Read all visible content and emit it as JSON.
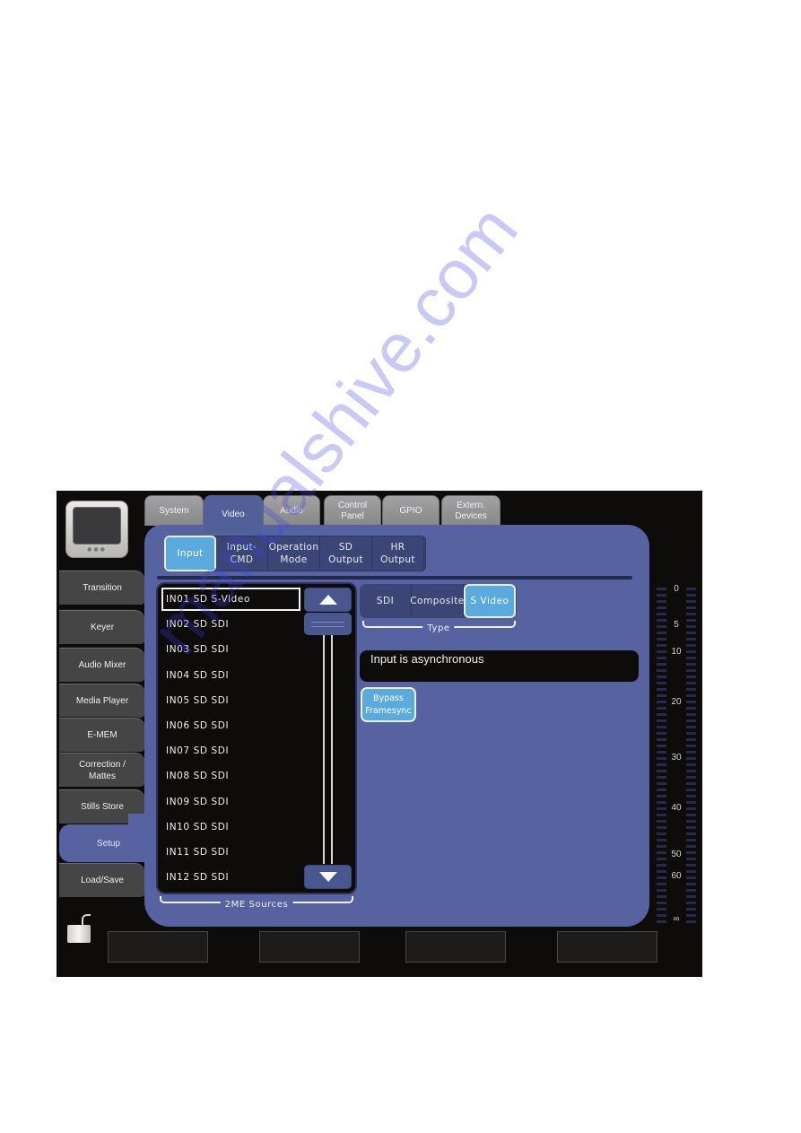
{
  "top_tabs": [
    {
      "label": "System",
      "active": false
    },
    {
      "label": "Video",
      "active": true
    },
    {
      "label": "Audio",
      "active": false
    },
    {
      "label": "Control\nPanel",
      "active": false
    },
    {
      "label": "GPIO",
      "active": false
    },
    {
      "label": "Extern.\nDevices",
      "active": false
    }
  ],
  "sub_tabs": [
    {
      "label": "Input",
      "active": true
    },
    {
      "label": "Input-\nCMD",
      "active": false
    },
    {
      "label": "Operation\nMode",
      "active": false
    },
    {
      "label": "SD\nOutput",
      "active": false
    },
    {
      "label": "HR\nOutput",
      "active": false
    }
  ],
  "sidebar": [
    {
      "label": "Transition",
      "active": false
    },
    {
      "label": "Keyer",
      "active": false
    },
    {
      "label": "Audio Mixer",
      "active": false
    },
    {
      "label": "Media Player",
      "active": false
    },
    {
      "label": "E-MEM",
      "active": false
    },
    {
      "label": "Correction /\nMattes",
      "active": false
    },
    {
      "label": "Stills Store",
      "active": false
    },
    {
      "label": "Setup",
      "active": true
    },
    {
      "label": "Load/Save",
      "active": false
    }
  ],
  "sources": {
    "group_label": "2ME Sources",
    "items": [
      "IN01 SD S-Video",
      "IN02 SD SDI",
      "IN03 SD SDI",
      "IN04 SD SDI",
      "IN05 SD SDI",
      "IN06 SD SDI",
      "IN07 SD SDI",
      "IN08 SD SDI",
      "IN09 SD SDI",
      "IN10 SD SDI",
      "IN11 SD SDI",
      "IN12 SD SDI"
    ],
    "selected_index": 0
  },
  "type": {
    "group_label": "Type",
    "options": [
      "SDI",
      "Composite",
      "S Video"
    ],
    "selected": "S Video"
  },
  "status_text": "Input is asynchronous",
  "bypass_button": "Bypass\nFramesync",
  "meter": {
    "scale_labels": [
      "0",
      "5",
      "10",
      "20",
      "30",
      "40",
      "50",
      "60",
      "∞"
    ]
  },
  "watermark": "manualshive.com",
  "colors": {
    "panel": "#5663a0",
    "active_accent": "#5aaae0",
    "background": "#0d0c0b"
  }
}
